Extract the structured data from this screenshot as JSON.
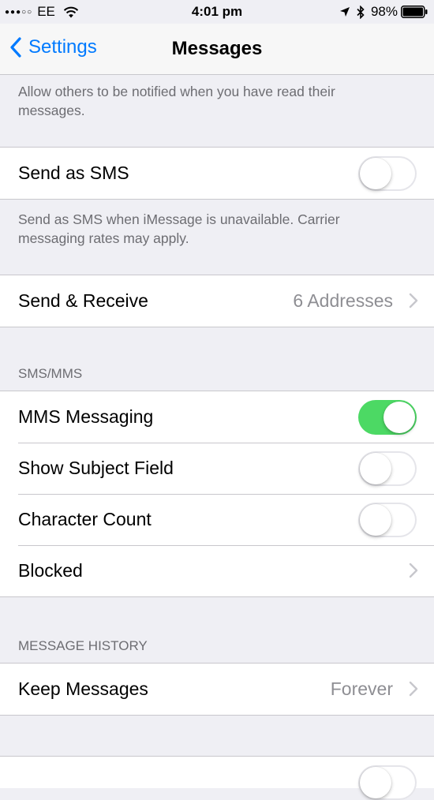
{
  "status_bar": {
    "signal": "●●●○○",
    "carrier": "EE",
    "time": "4:01 pm",
    "battery": "98%"
  },
  "nav": {
    "back_label": "Settings",
    "title": "Messages"
  },
  "read_receipts_footer": "Allow others to be notified when you have read their messages.",
  "send_as_sms": {
    "label": "Send as SMS",
    "on": false,
    "footer": "Send as SMS when iMessage is unavailable. Carrier messaging rates may apply."
  },
  "send_receive": {
    "label": "Send & Receive",
    "detail": "6 Addresses"
  },
  "sms_mms": {
    "header": "SMS/MMS",
    "mms_messaging": {
      "label": "MMS Messaging",
      "on": true
    },
    "show_subject_field": {
      "label": "Show Subject Field",
      "on": false
    },
    "character_count": {
      "label": "Character Count",
      "on": false
    },
    "blocked": {
      "label": "Blocked"
    }
  },
  "message_history": {
    "header": "MESSAGE HISTORY",
    "keep_messages": {
      "label": "Keep Messages",
      "detail": "Forever"
    }
  },
  "icons": {
    "back": "chevron-left-icon",
    "disclosure": "chevron-right-icon",
    "wifi": "wifi-icon",
    "location": "location-arrow-icon",
    "bluetooth": "bluetooth-icon",
    "battery": "battery-icon"
  },
  "colors": {
    "accent": "#007aff",
    "switch_on": "#4cd964",
    "background": "#efeff4",
    "secondary_text": "#8e8e93"
  }
}
